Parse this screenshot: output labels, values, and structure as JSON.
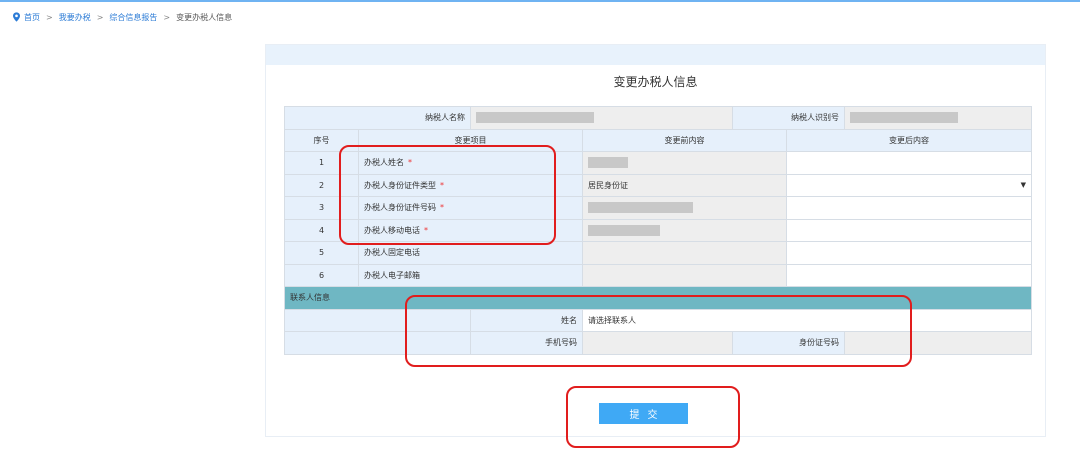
{
  "breadcrumb": {
    "items": [
      "首页",
      "我要办税",
      "综合信息报告"
    ],
    "separator": ">",
    "current": "变更办税人信息"
  },
  "page_title": "变更办税人信息",
  "taxpayer": {
    "name_label": "纳税人名称",
    "id_label": "纳税人识别号"
  },
  "table": {
    "headers": {
      "index": "序号",
      "item": "变更项目",
      "before": "变更前内容",
      "after": "变更后内容"
    },
    "rows": [
      {
        "index": "1",
        "label": "办税人姓名",
        "required": "*",
        "before": ""
      },
      {
        "index": "2",
        "label": "办税人身份证件类型",
        "required": "*",
        "before": "居民身份证"
      },
      {
        "index": "3",
        "label": "办税人身份证件号码",
        "required": "*",
        "before": ""
      },
      {
        "index": "4",
        "label": "办税人移动电话",
        "required": "*",
        "before": ""
      },
      {
        "index": "5",
        "label": "办税人固定电话",
        "required": "",
        "before": ""
      },
      {
        "index": "6",
        "label": "办税人电子邮箱",
        "required": "",
        "before": ""
      }
    ],
    "id_type_caret": "▼"
  },
  "contact": {
    "section_label": "联系人信息",
    "name_label": "姓名",
    "name_placeholder": "请选择联系人",
    "phone_label": "手机号码",
    "idcard_label": "身份证号码"
  },
  "submit_label": "提交",
  "colors": {
    "accent": "#3fa9f5",
    "section": "#6fb7c3",
    "annotation": "#e11d1d",
    "link": "#2b7bd6"
  }
}
